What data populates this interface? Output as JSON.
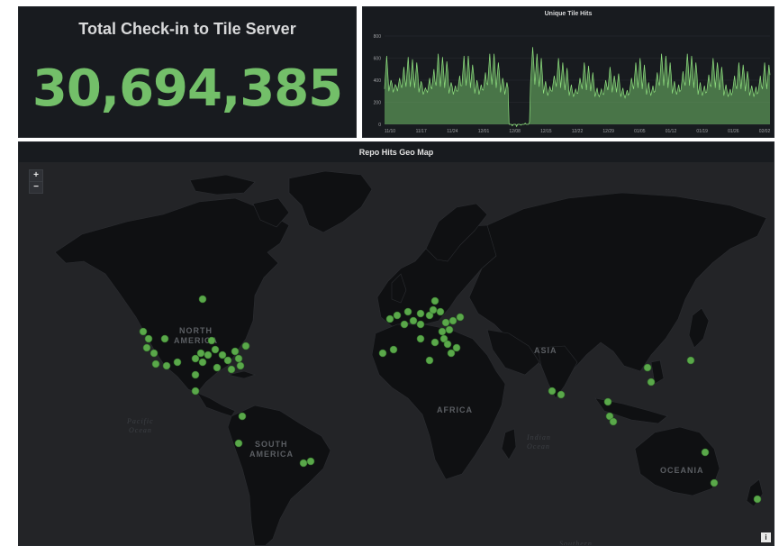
{
  "stat": {
    "title": "Total Check-in to Tile Server",
    "value": "30,694,385",
    "color": "#73bf69"
  },
  "chart_data": {
    "type": "area",
    "title": "Unique Tile Hits",
    "xlabel": "",
    "ylabel": "",
    "ylim": [
      0,
      800
    ],
    "yticks": [
      "0",
      "200",
      "400",
      "600",
      "800"
    ],
    "xticks": [
      "11/10",
      "11/17",
      "11/24",
      "12/01",
      "12/08",
      "12/15",
      "12/22",
      "12/29",
      "01/05",
      "01/12",
      "01/19",
      "01/26",
      "02/02"
    ],
    "grid": true,
    "series": [
      {
        "color": "#73bf69",
        "daily_peaks": [
          620,
          400,
          360,
          420,
          520,
          610,
          590,
          560,
          390,
          330,
          420,
          500,
          640,
          610,
          570,
          380,
          350,
          440,
          620,
          620,
          540,
          400,
          360,
          470,
          640,
          640,
          560,
          420,
          380,
          0,
          0,
          0,
          0,
          0,
          700,
          640,
          600,
          390,
          340,
          440,
          600,
          560,
          510,
          360,
          320,
          420,
          560,
          530,
          470,
          330,
          320,
          400,
          520,
          440,
          460,
          330,
          310,
          420,
          560,
          600,
          540,
          380,
          350,
          470,
          640,
          620,
          560,
          390,
          360,
          480,
          640,
          620,
          560,
          380,
          350,
          450,
          600,
          560,
          520,
          360,
          320,
          440,
          560,
          540,
          480,
          350,
          340,
          440,
          560,
          540
        ],
        "daily_lows": [
          320,
          300,
          290,
          300,
          330,
          340,
          340,
          330,
          290,
          270,
          290,
          320,
          350,
          340,
          330,
          280,
          270,
          300,
          350,
          350,
          330,
          280,
          270,
          310,
          360,
          360,
          330,
          290,
          270,
          0,
          0,
          0,
          0,
          0,
          380,
          360,
          340,
          280,
          260,
          300,
          340,
          330,
          310,
          260,
          250,
          280,
          320,
          310,
          300,
          250,
          250,
          270,
          310,
          290,
          290,
          250,
          240,
          280,
          320,
          330,
          320,
          270,
          260,
          300,
          350,
          350,
          330,
          280,
          270,
          310,
          350,
          350,
          330,
          270,
          260,
          290,
          340,
          330,
          310,
          260,
          250,
          290,
          320,
          320,
          300,
          260,
          250,
          290,
          320,
          320
        ]
      }
    ]
  },
  "map": {
    "title": "Repo Hits Geo Map",
    "zoom_in_label": "+",
    "zoom_out_label": "−",
    "info_label": "i",
    "marker_color": "#5aa84a",
    "regions": [
      "NORTH AMERICA",
      "SOUTH AMERICA",
      "AFRICA",
      "ASIA",
      "OCEANIA"
    ],
    "oceans": [
      "Pacific Ocean",
      "Indian Ocean",
      "Southern Ocean"
    ]
  }
}
